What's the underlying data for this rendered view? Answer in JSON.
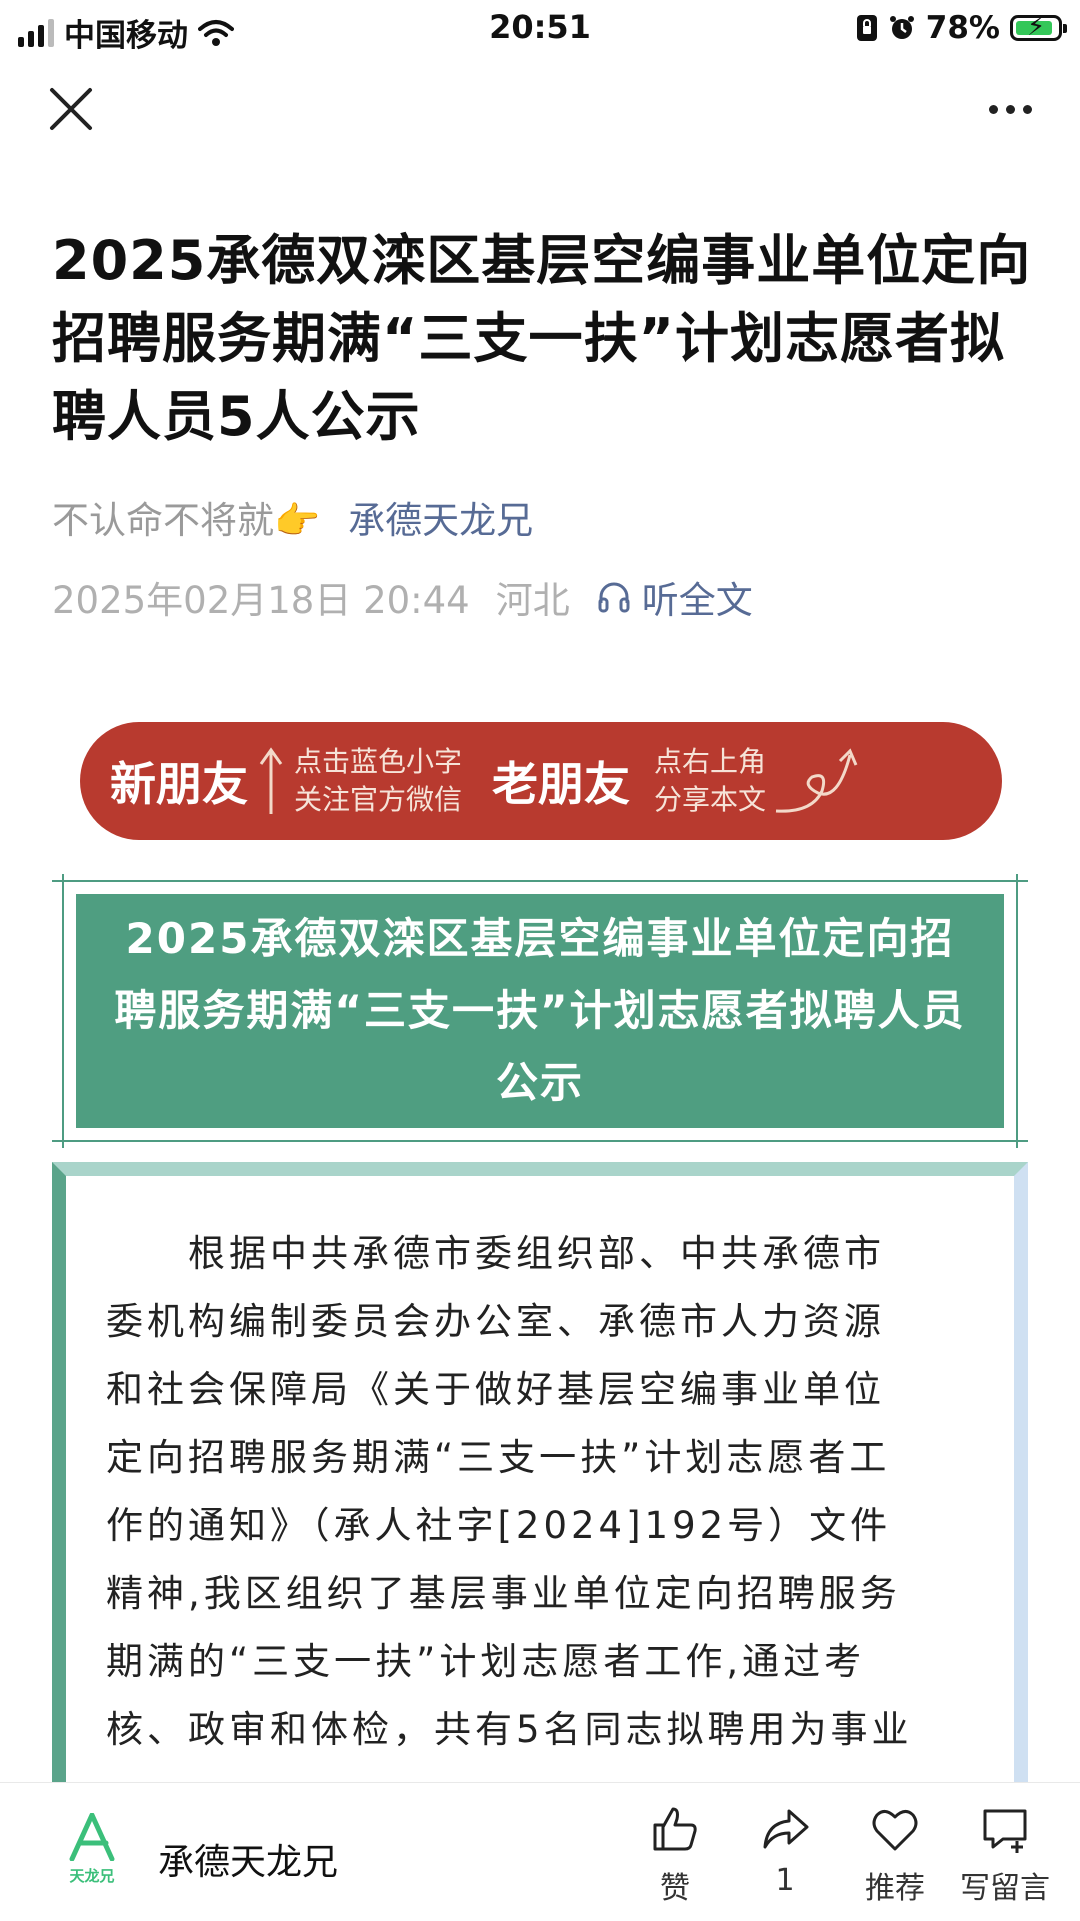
{
  "status_bar": {
    "carrier": "中国移动",
    "time": "20:51",
    "battery_percent": "78%",
    "battery_level": 0.78,
    "icons": [
      "signal-icon",
      "wifi-icon",
      "portrait-lock-icon",
      "alarm-icon",
      "battery-charging-icon"
    ]
  },
  "nav": {
    "close_icon": "close-icon",
    "more_icon": "more-icon"
  },
  "article": {
    "title": "2025承德双滦区基层空编事业单位定向招聘服务期满“三支一扶”计划志愿者拟聘人员5人公示",
    "author_note": "不认命不将就👉",
    "account_link": "承德天龙兄",
    "date": "2025年02月18日 20:44",
    "region": "河北",
    "listen_label": "听全文"
  },
  "banner": {
    "new_friend": "新朋友",
    "new_friend_hint_1": "点击蓝色小字",
    "new_friend_hint_2": "关注官方微信",
    "old_friend": "老朋友",
    "old_friend_hint_1": "点右上角",
    "old_friend_hint_2": "分享本文",
    "color": "#b83a2f"
  },
  "headline_box": {
    "text": "2025承德双滦区基层空编事业单位定向招聘服务期满“三支一扶”计划志愿者拟聘人员公示",
    "color": "#4f9e81"
  },
  "body_lines": [
    "　　根据中共承德市委组织部、中共承德市",
    "委机构编制委员会办公室、承德市人力资源",
    "和社会保障局《关于做好基层空编事业单位",
    "定向招聘服务期满“三支一扶”计划志愿者工",
    "作的通知》（承人社字[2024]192号）文件",
    "精神,我区组织了基层事业单位定向招聘服务",
    "期满的“三支一扶”计划志愿者工作,通过考",
    "核、政审和体检，共有5名同志拟聘用为事业"
  ],
  "bottom_bar": {
    "account_logo_text": "天龙兄",
    "account_name": "承德天龙兄",
    "like_label": "赞",
    "share_count": "1",
    "recommend_label": "推荐",
    "comment_label": "写留言"
  }
}
